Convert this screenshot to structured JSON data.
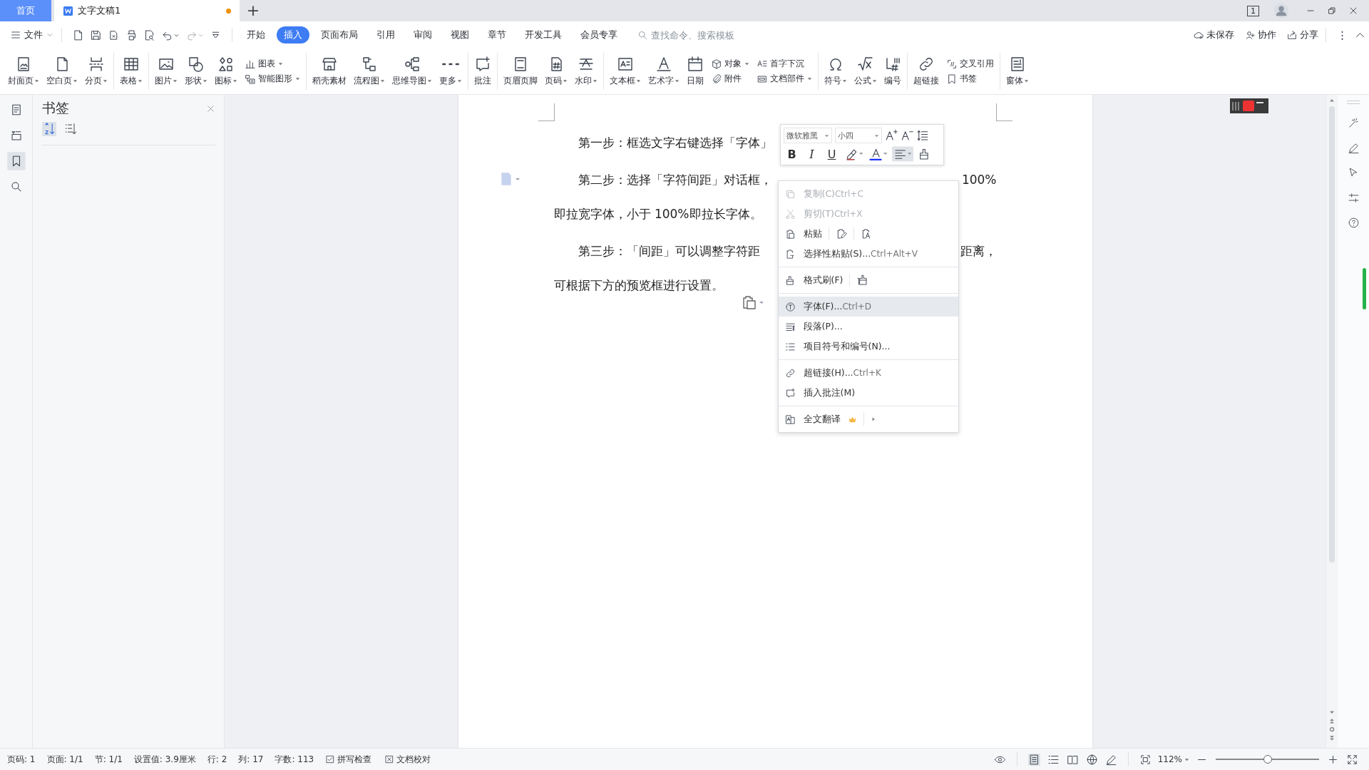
{
  "tabs": [
    {
      "label": "首页",
      "kind": "home",
      "selected": false,
      "unsaved": false
    },
    {
      "label": "文字文稿1",
      "kind": "document",
      "selected": true,
      "unsaved": true
    }
  ],
  "new_tab": "+",
  "window_badge": "1",
  "menu": {
    "file": "文件",
    "tabs": [
      {
        "label": "开始",
        "selected": false
      },
      {
        "label": "插入",
        "selected": true
      },
      {
        "label": "页面布局",
        "selected": false
      },
      {
        "label": "引用",
        "selected": false
      },
      {
        "label": "审阅",
        "selected": false
      },
      {
        "label": "视图",
        "selected": false
      },
      {
        "label": "章节",
        "selected": false
      },
      {
        "label": "开发工具",
        "selected": false
      },
      {
        "label": "会员专享",
        "selected": false
      }
    ],
    "search": {
      "placeholder": "查找命令、搜索模板"
    },
    "actions": [
      "未保存",
      "协作",
      "分享"
    ]
  },
  "ribbon": [
    [
      {
        "kind": "large",
        "label": "封面页",
        "dropdown": true
      },
      {
        "kind": "large",
        "label": "空白页",
        "dropdown": true
      },
      {
        "kind": "large",
        "label": "分页",
        "dropdown": true
      }
    ],
    [
      {
        "kind": "large",
        "label": "表格",
        "dropdown": true
      }
    ],
    [
      {
        "kind": "large",
        "label": "图片",
        "dropdown": true
      },
      {
        "kind": "large",
        "label": "形状",
        "dropdown": true
      },
      {
        "kind": "large",
        "label": "图标",
        "dropdown": true
      },
      {
        "kind": "stack",
        "items": [
          {
            "label": "图表",
            "dropdown": true
          },
          {
            "label": "智能图形",
            "dropdown": true
          }
        ]
      }
    ],
    [
      {
        "kind": "large",
        "label": "稻壳素材",
        "dropdown": false
      },
      {
        "kind": "large",
        "label": "流程图",
        "dropdown": true
      },
      {
        "kind": "large",
        "label": "思维导图",
        "dropdown": true
      },
      {
        "kind": "large",
        "label": "更多",
        "dropdown": true
      }
    ],
    [
      {
        "kind": "large",
        "label": "批注",
        "dropdown": false
      }
    ],
    [
      {
        "kind": "large",
        "label": "页眉页脚",
        "dropdown": false
      },
      {
        "kind": "large",
        "label": "页码",
        "dropdown": true
      },
      {
        "kind": "large",
        "label": "水印",
        "dropdown": true
      }
    ],
    [
      {
        "kind": "large",
        "label": "文本框",
        "dropdown": true
      },
      {
        "kind": "large",
        "label": "艺术字",
        "dropdown": true
      },
      {
        "kind": "large",
        "label": "日期",
        "dropdown": false
      },
      {
        "kind": "stack",
        "items": [
          {
            "label": "对象",
            "dropdown": true
          },
          {
            "label": "附件",
            "dropdown": false
          }
        ]
      },
      {
        "kind": "stack",
        "items": [
          {
            "label": "首字下沉",
            "dropdown": false
          },
          {
            "label": "文档部件",
            "dropdown": true
          }
        ]
      }
    ],
    [
      {
        "kind": "large",
        "label": "符号",
        "dropdown": true
      },
      {
        "kind": "large",
        "label": "公式",
        "dropdown": true
      },
      {
        "kind": "large",
        "label": "编号",
        "dropdown": false
      }
    ],
    [
      {
        "kind": "large",
        "label": "超链接",
        "dropdown": false
      },
      {
        "kind": "stack",
        "items": [
          {
            "label": "交叉引用",
            "dropdown": false
          },
          {
            "label": "书签",
            "dropdown": false
          }
        ]
      }
    ],
    [
      {
        "kind": "large",
        "label": "窗体",
        "dropdown": true
      }
    ]
  ],
  "sidebar": {
    "items": [
      {
        "selected": false
      },
      {
        "selected": false
      },
      {
        "selected": true
      },
      {
        "selected": false
      }
    ],
    "panel": {
      "title": "书签",
      "sort_buttons": [
        {
          "selected": true
        },
        {
          "selected": false
        }
      ]
    }
  },
  "document": {
    "paragraphs": [
      {
        "lines": [
          [
            "第一步：框选文字右键选择「字体」"
          ]
        ]
      },
      {
        "lines": [
          [
            "第二步：选择「字符间距」对话框，",
            "100%"
          ],
          [
            "即拉宽字体，小于 100%即拉长字体。"
          ]
        ]
      },
      {
        "lines": [
          [
            "第三步：「间距」可以调整字符距",
            "距离，"
          ],
          [
            "可根据下方的预览框进行设置。"
          ]
        ]
      }
    ]
  },
  "mini_toolbar": {
    "font": "微软雅黑",
    "size": "小四",
    "buttons": [
      {
        "kind": "bold",
        "label": "B",
        "selected": false
      },
      {
        "kind": "italic",
        "label": "I",
        "selected": false
      },
      {
        "kind": "underline",
        "label": "U",
        "selected": false
      },
      {
        "kind": "highlight",
        "selected": false
      },
      {
        "kind": "font-color",
        "selected": false
      },
      {
        "kind": "align",
        "selected": true
      },
      {
        "kind": "painter",
        "selected": false
      }
    ]
  },
  "context_menu": [
    {
      "kind": "item",
      "label": "复制(C)",
      "shortcut": "Ctrl+C",
      "disabled": true,
      "selected": false
    },
    {
      "kind": "item",
      "label": "剪切(T)",
      "shortcut": "Ctrl+X",
      "disabled": true,
      "selected": false
    },
    {
      "kind": "paste",
      "label": "粘贴",
      "disabled": false,
      "selected": false
    },
    {
      "kind": "item",
      "label": "选择性粘贴(S)...",
      "shortcut": "Ctrl+Alt+V",
      "disabled": false,
      "selected": false
    },
    {
      "kind": "separator"
    },
    {
      "kind": "painter",
      "label": "格式刷(F)",
      "disabled": false,
      "selected": false
    },
    {
      "kind": "separator"
    },
    {
      "kind": "item",
      "label": "字体(F)...",
      "shortcut": "Ctrl+D",
      "disabled": false,
      "selected": true
    },
    {
      "kind": "item",
      "label": "段落(P)...",
      "disabled": false,
      "selected": false
    },
    {
      "kind": "item",
      "label": "项目符号和编号(N)...",
      "disabled": false,
      "selected": false
    },
    {
      "kind": "separator"
    },
    {
      "kind": "item",
      "label": "超链接(H)...",
      "shortcut": "Ctrl+K",
      "disabled": false,
      "selected": false
    },
    {
      "kind": "item",
      "label": "插入批注(M)",
      "disabled": false,
      "selected": false
    },
    {
      "kind": "separator"
    },
    {
      "kind": "translate",
      "label": "全文翻译",
      "disabled": false,
      "selected": false
    }
  ],
  "status_bar": {
    "items": [
      "页码: 1",
      "页面: 1/1",
      "节: 1/1",
      "设置值: 3.9厘米",
      "行: 2",
      "列: 17",
      "字数: 113"
    ],
    "checks": [
      {
        "kind": "checkbox",
        "label": "拼写检查",
        "checked": true
      },
      {
        "kind": "tool",
        "label": "文档校对"
      }
    ],
    "views": [
      {
        "selected": true
      },
      {
        "selected": false
      },
      {
        "selected": false
      },
      {
        "selected": false
      }
    ],
    "zoom": "112%",
    "zoom_slider": {
      "level": 0.5
    }
  }
}
